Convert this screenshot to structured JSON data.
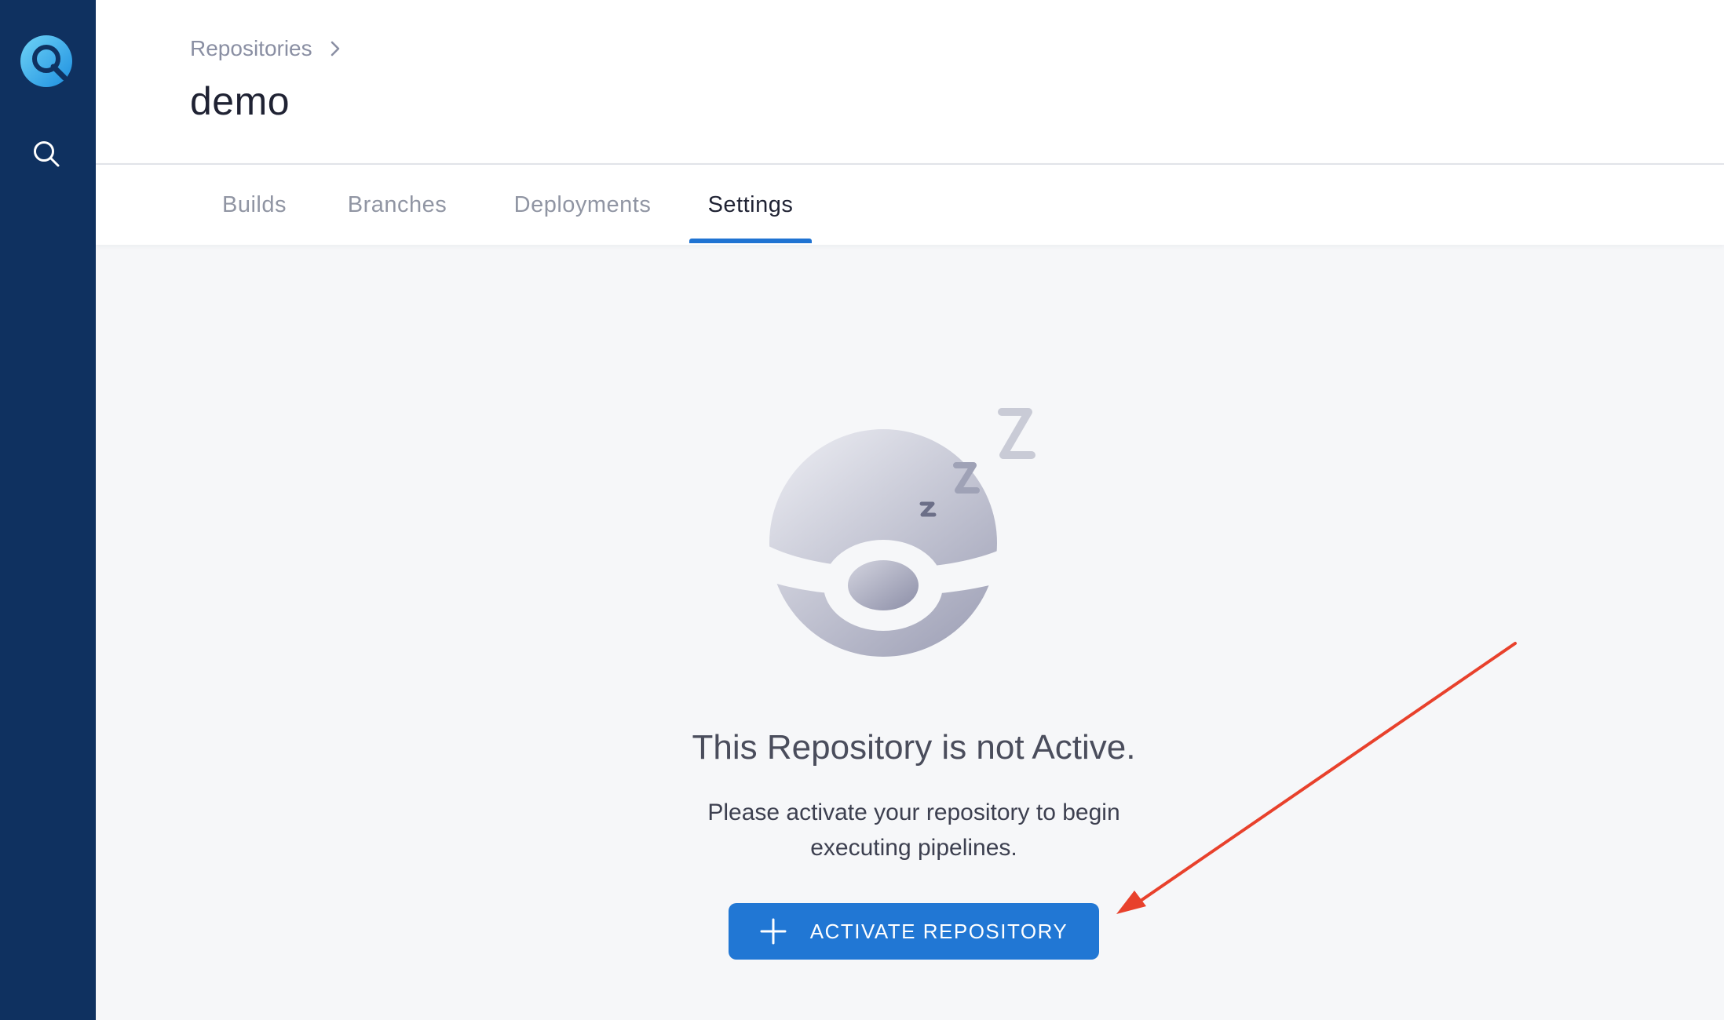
{
  "sidebar": {
    "logo_icon": "app-logo-icon",
    "search_icon": "search-icon"
  },
  "header": {
    "breadcrumb": "Repositories",
    "title": "demo"
  },
  "tabs": [
    {
      "label": "Builds",
      "active": false
    },
    {
      "label": "Branches",
      "active": false
    },
    {
      "label": "Deployments",
      "active": false
    },
    {
      "label": "Settings",
      "active": true
    }
  ],
  "empty_state": {
    "illustration": "sleeping-ball-illustration",
    "title": "This Repository is not Active.",
    "description_line1": "Please activate your repository to begin",
    "description_line2": "executing pipelines.",
    "button_label": "ACTIVATE REPOSITORY",
    "button_icon": "plus-icon"
  },
  "colors": {
    "sidebar": "#0f3160",
    "accent": "#1f73d2",
    "button": "#2177d4",
    "annotation_arrow": "#e8412c"
  }
}
